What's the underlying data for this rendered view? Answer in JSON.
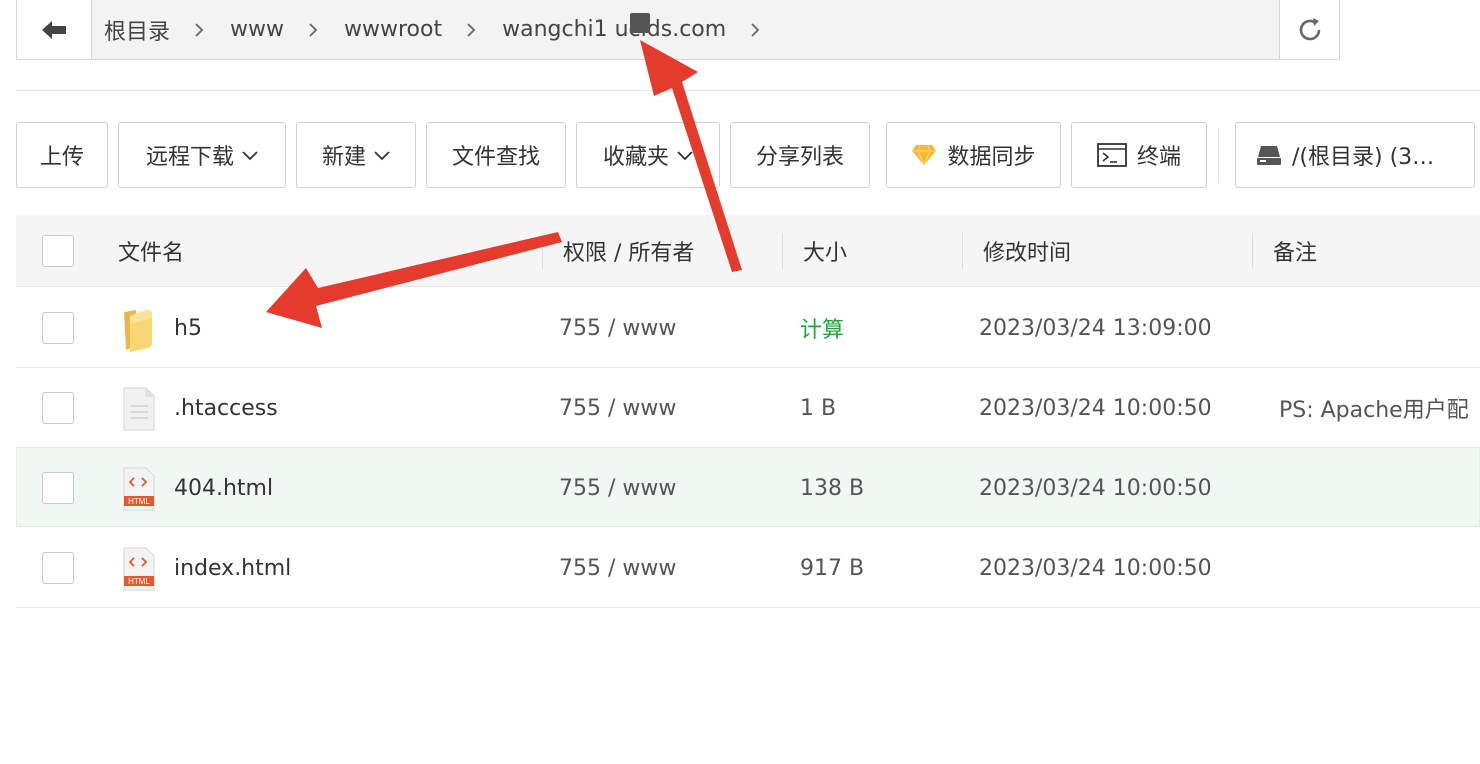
{
  "path": {
    "crumbs": [
      "根目录",
      "www",
      "wwwroot",
      "wangchi1 uclds.com"
    ]
  },
  "toolbar": {
    "upload": "上传",
    "remote_download": "远程下载",
    "new": "新建",
    "find": "文件查找",
    "favorites": "收藏夹",
    "share_list": "分享列表",
    "sync": "数据同步",
    "terminal": "终端",
    "disk": "/(根目录) (3…"
  },
  "table": {
    "headers": {
      "name": "文件名",
      "perm": "权限 / 所有者",
      "size": "大小",
      "mtime": "修改时间",
      "note": "备注"
    },
    "rows": [
      {
        "name": "h5",
        "perm": "755 / www",
        "size": "计算",
        "mtime": "2023/03/24 13:09:00",
        "note": "",
        "type": "folder"
      },
      {
        "name": ".htaccess",
        "perm": "755 / www",
        "size": "1 B",
        "mtime": "2023/03/24 10:00:50",
        "note": "PS: Apache用户配",
        "type": "text"
      },
      {
        "name": "404.html",
        "perm": "755 / www",
        "size": "138 B",
        "mtime": "2023/03/24 10:00:50",
        "note": "",
        "type": "html"
      },
      {
        "name": "index.html",
        "perm": "755 / www",
        "size": "917 B",
        "mtime": "2023/03/24 10:00:50",
        "note": "",
        "type": "html"
      }
    ]
  },
  "icons": {
    "html_badge": "HTML",
    "accent_green": "#20a53a",
    "annotation_red": "#e53b2c"
  }
}
